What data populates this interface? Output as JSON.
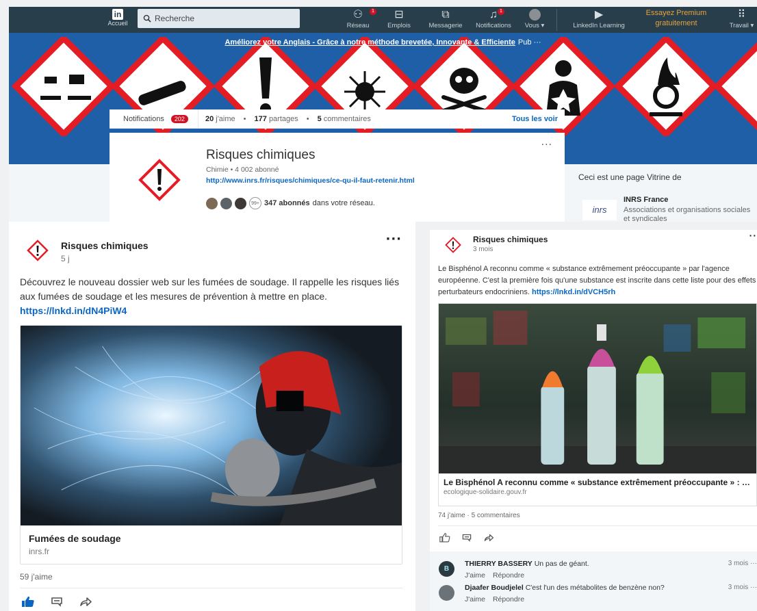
{
  "nav": {
    "home_label": "Accueil",
    "logo_text": "in",
    "search_placeholder": "Recherche",
    "items": [
      {
        "label": "Réseau",
        "badge": "1"
      },
      {
        "label": "Emplois",
        "badge": ""
      },
      {
        "label": "Messagerie",
        "badge": ""
      },
      {
        "label": "Notifications",
        "badge": "1"
      },
      {
        "label": "Vous ▾",
        "badge": ""
      },
      {
        "label": "LinkedIn Learning",
        "badge": ""
      }
    ],
    "premium_line1": "Essayez Premium",
    "premium_line2": "gratuitement",
    "work_label": "Travail ▾"
  },
  "banner": {
    "ad_text": "Améliorez votre Anglais - Grâce à notre méthode brevetée, Innovante & Efficiente",
    "pub_label": "Pub ···",
    "colors": {
      "blue": "#1e5fa8",
      "hazard_red": "#e41c24"
    }
  },
  "notifications_bar": {
    "label": "Notifications",
    "count": "202",
    "likes_num": "20",
    "likes_label": "j'aime",
    "shares_num": "177",
    "shares_label": "partages",
    "comments_num": "5",
    "comments_label": "commentaires",
    "see_all": "Tous les voir"
  },
  "page": {
    "name": "Risques chimiques",
    "meta": "Chimie • 4 002 abonné",
    "url": "http://www.inrs.fr/risques/chimiques/ce-qu-il-faut-retenir.html",
    "network_count": "347 abonnés",
    "network_suffix": " dans votre réseau.",
    "plus_badge": "99+"
  },
  "showcase": {
    "title": "Ceci est une page Vitrine de",
    "org_name": "INRS France",
    "org_logo_text": "inrs",
    "org_category": "Associations et organisations sociales et syndicales"
  },
  "post_left": {
    "author": "Risques chimiques",
    "time": "5 j",
    "text": "Découvrez le nouveau dossier web sur les fumées de soudage. Il rappelle les risques liés aux fumées de soudage et les mesures de prévention à mettre en place. ",
    "link": "https://lnkd.in/dN4PiW4",
    "media_title": "Fumées de soudage",
    "media_source": "inrs.fr",
    "likes": "59 j'aime"
  },
  "post_right": {
    "author": "Risques chimiques",
    "time": "3 mois",
    "text": "Le Bisphénol A reconnu comme « substance extrêmement préoccupante » par l'agence européenne. C'est la première fois qu'une substance est inscrite dans cette liste pour des effets perturbateurs endocriniens. ",
    "link": "https://lnkd.in/dVCH5rh",
    "media_title": "Le Bisphénol A reconnu comme « substance extrêmement préoccupante » : …",
    "media_source": "ecologique-solidaire.gouv.fr",
    "stats": "74 j'aime · 5 commentaires",
    "comments": [
      {
        "author": "THIERRY BASSERY",
        "text": " Un pas de géant.",
        "when": "3 mois ···",
        "like": "J'aime",
        "reply": "Répondre",
        "avatar_text": "B"
      },
      {
        "author": "Djaafer Boudjelel",
        "text": " C'est l'un des métabolites de benzène non?",
        "when": "3 mois ···",
        "like": "J'aime",
        "reply": "Répondre",
        "avatar_text": ""
      }
    ]
  }
}
